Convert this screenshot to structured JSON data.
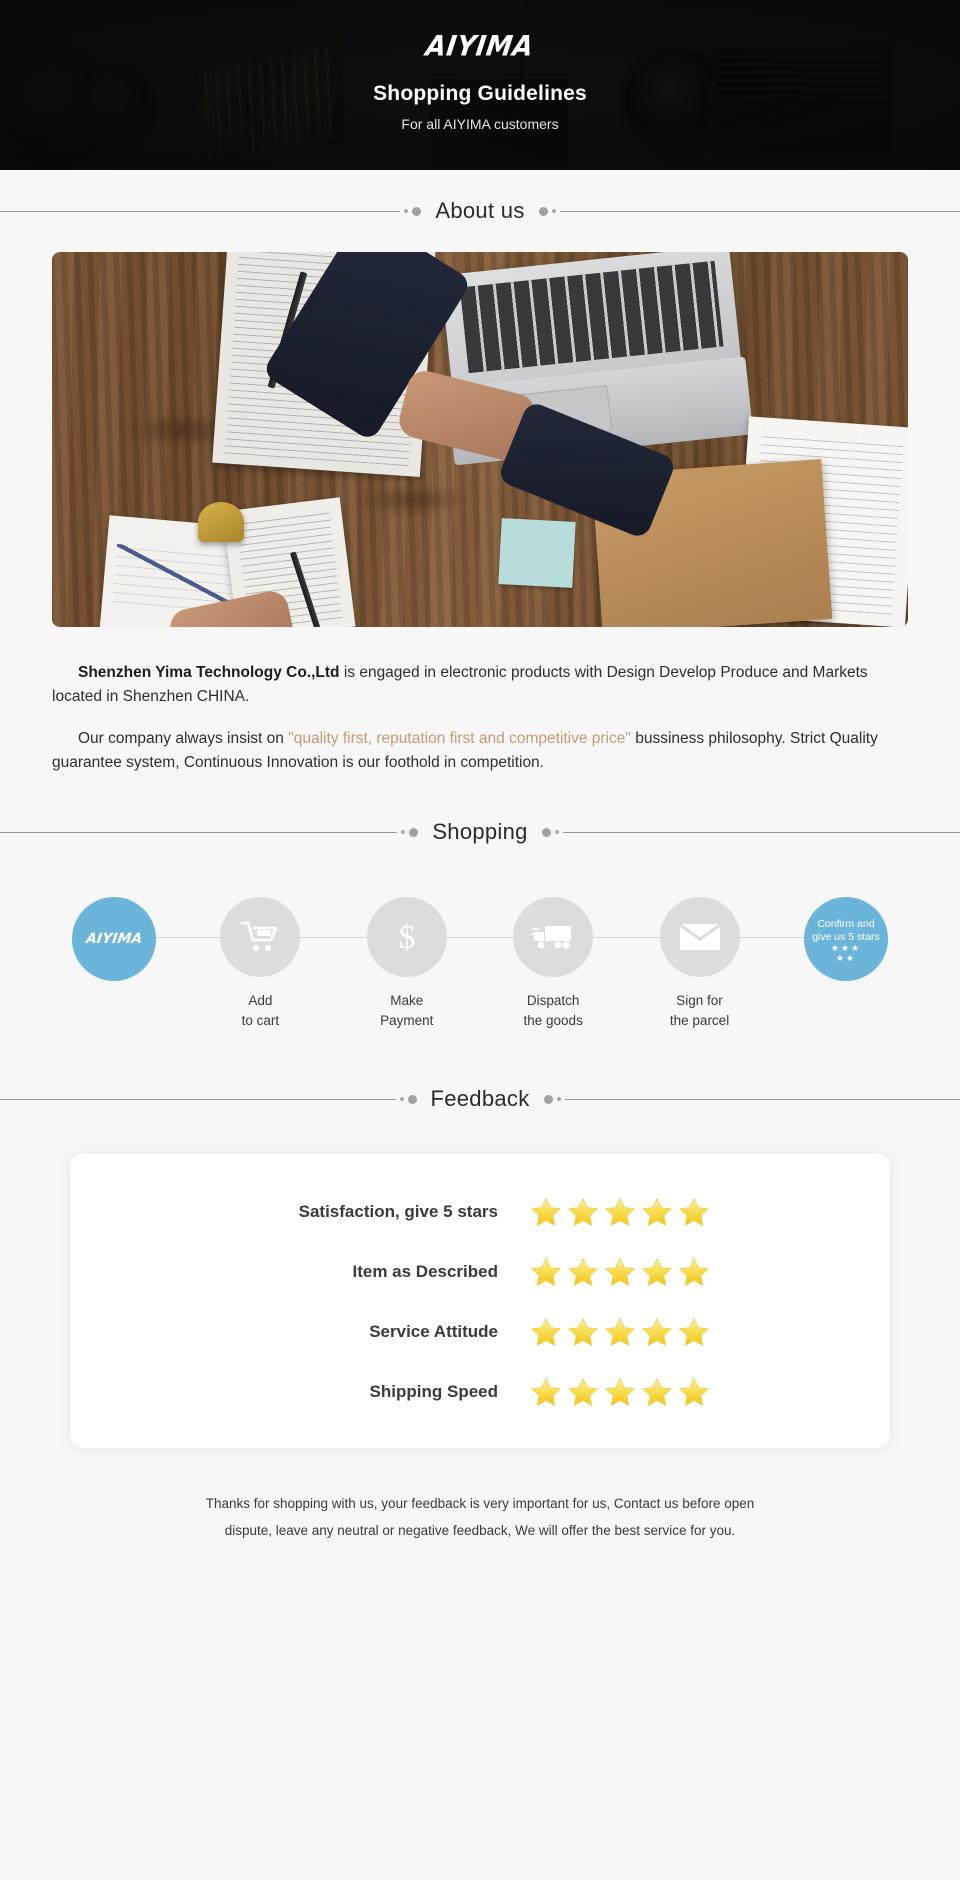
{
  "hero": {
    "brand": "AIYIMA",
    "title": "Shopping Guidelines",
    "subtitle": "For all AIYIMA customers"
  },
  "sections": {
    "about_title": "About us",
    "shopping_title": "Shopping",
    "feedback_title": "Feedback"
  },
  "about": {
    "p1_bold": "Shenzhen Yima Technology Co.,Ltd",
    "p1_rest": " is engaged in electronic products with Design Develop Produce and Markets located in Shenzhen CHINA.",
    "p2_a": "Our company always insist on ",
    "p2_quote": "\"quality first, reputation first and competitive price\"",
    "p2_b": " bussiness philosophy. Strict Quality guarantee system, Continuous Innovation is our foothold in competition."
  },
  "shopping": {
    "steps": [
      {
        "icon": "aiyima-logo-icon",
        "logo": "AIYIMA",
        "label": ""
      },
      {
        "icon": "shopping-cart-icon",
        "label": "Add\nto cart",
        "line1": "Add",
        "line2": "to cart"
      },
      {
        "icon": "dollar-icon",
        "label": "Make Payment",
        "line1": "Make",
        "line2": "Payment"
      },
      {
        "icon": "delivery-truck-icon",
        "label": "Dispatch the goods",
        "line1": "Dispatch",
        "line2": "the goods"
      },
      {
        "icon": "envelope-icon",
        "label": "Sign for the parcel",
        "line1": "Sign for",
        "line2": "the parcel"
      },
      {
        "icon": "five-star-icon",
        "confirm_line1": "Confirm and",
        "confirm_line2": "give us 5 stars",
        "stars_top": "★★★",
        "stars_bottom": "★★",
        "label": ""
      }
    ]
  },
  "feedback": {
    "rows": [
      {
        "label": "Satisfaction, give 5 stars",
        "stars": 5
      },
      {
        "label": "Item as Described",
        "stars": 5
      },
      {
        "label": "Service Attitude",
        "stars": 5
      },
      {
        "label": "Shipping Speed",
        "stars": 5
      }
    ]
  },
  "footer": {
    "line1": "Thanks for shopping with us, your feedback is very important for us, Contact us before open",
    "line2": "dispute, leave any neutral or negative feedback, We will offer the best service for you."
  },
  "colors": {
    "accent_blue": "#6bb5da",
    "quote_brown": "#c79a72",
    "star_yellow": "#f7d74a",
    "page_bg": "#f7f7f7",
    "hero_bg": "#121212"
  }
}
